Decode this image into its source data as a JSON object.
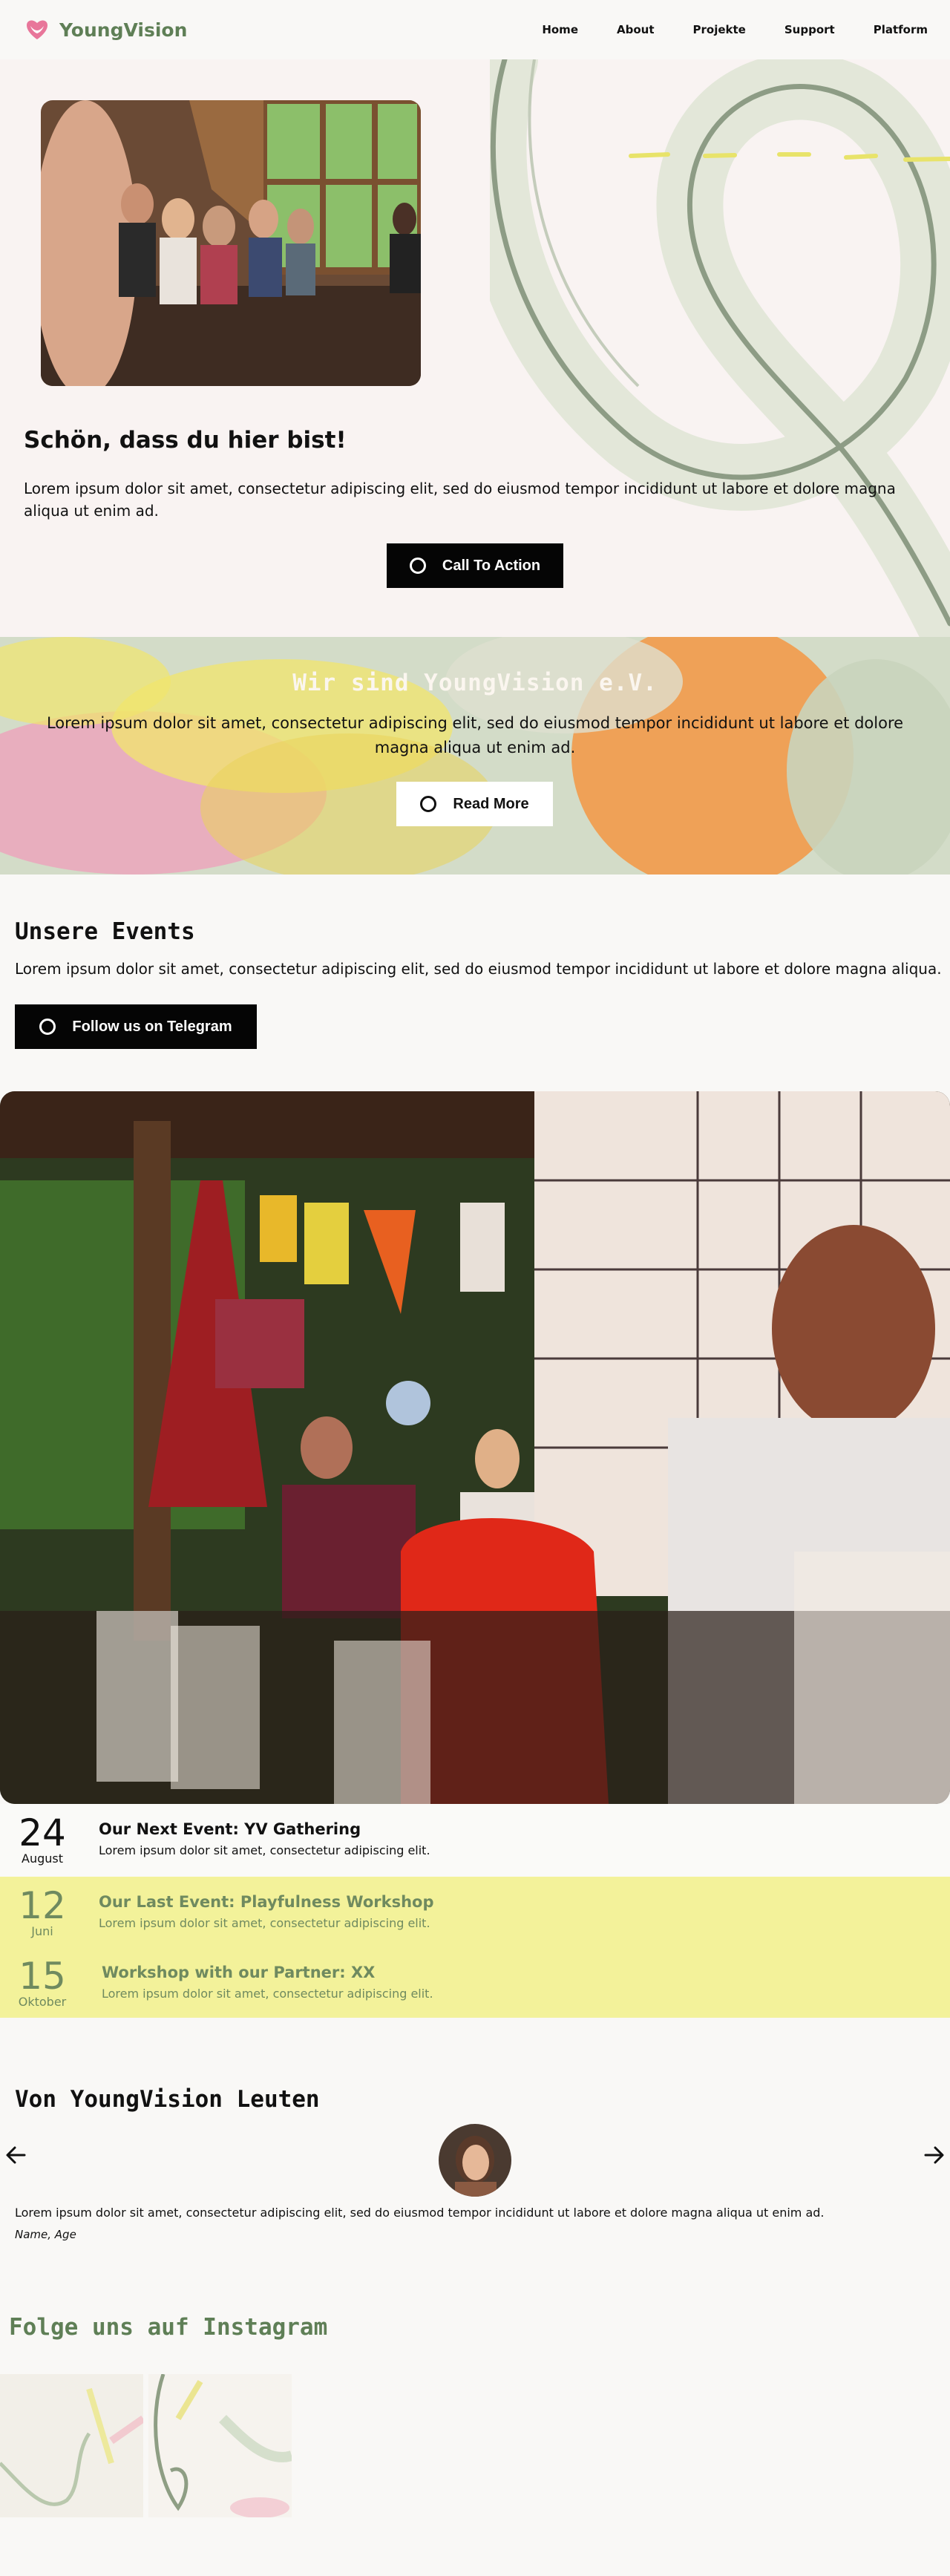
{
  "header": {
    "brand": "YoungVision",
    "nav": [
      "Home",
      "About",
      "Projekte",
      "Support",
      "Platform"
    ]
  },
  "hero": {
    "title": "Schön, dass du hier bist!",
    "text": "Lorem ipsum dolor sit amet, consectetur adipiscing elit, sed do eiusmod tempor incididunt ut labore et dolore magna aliqua ut enim ad.",
    "cta": "Call To Action"
  },
  "about": {
    "title": "Wir sind YoungVision e.V.",
    "text": "Lorem ipsum dolor sit amet, consectetur adipiscing elit, sed do eiusmod tempor incididunt ut labore et dolore magna aliqua ut enim ad.",
    "cta": "Read More"
  },
  "events": {
    "title": "Unsere Events",
    "text": "Lorem ipsum dolor sit amet, consectetur adipiscing elit, sed do eiusmod tempor incididunt ut labore et dolore magna aliqua.",
    "telegram": "Follow us on Telegram",
    "list": [
      {
        "day": "24",
        "month": "August",
        "title": "Our Next Event: YV Gathering",
        "desc": "Lorem ipsum dolor sit amet, consectetur adipiscing elit."
      },
      {
        "day": "12",
        "month": "Juni",
        "title": "Our Last Event: Playfulness Workshop",
        "desc": "Lorem ipsum dolor sit amet, consectetur adipiscing elit."
      },
      {
        "day": "15",
        "month": "Oktober",
        "title": "Workshop with our Partner: XX",
        "desc": "Lorem ipsum dolor sit amet, consectetur adipiscing elit."
      }
    ]
  },
  "people": {
    "title": "Von YoungVision Leuten",
    "quote": "Lorem ipsum dolor sit amet, consectetur adipiscing elit, sed do eiusmod tempor incididunt ut labore et dolore magna aliqua ut enim ad.",
    "author": "Name, Age"
  },
  "instagram": {
    "title": "Folge uns auf Instagram"
  },
  "colors": {
    "brand_green": "#5f7f56",
    "event_yellow": "#f3f29a",
    "button_dark": "#050505"
  }
}
